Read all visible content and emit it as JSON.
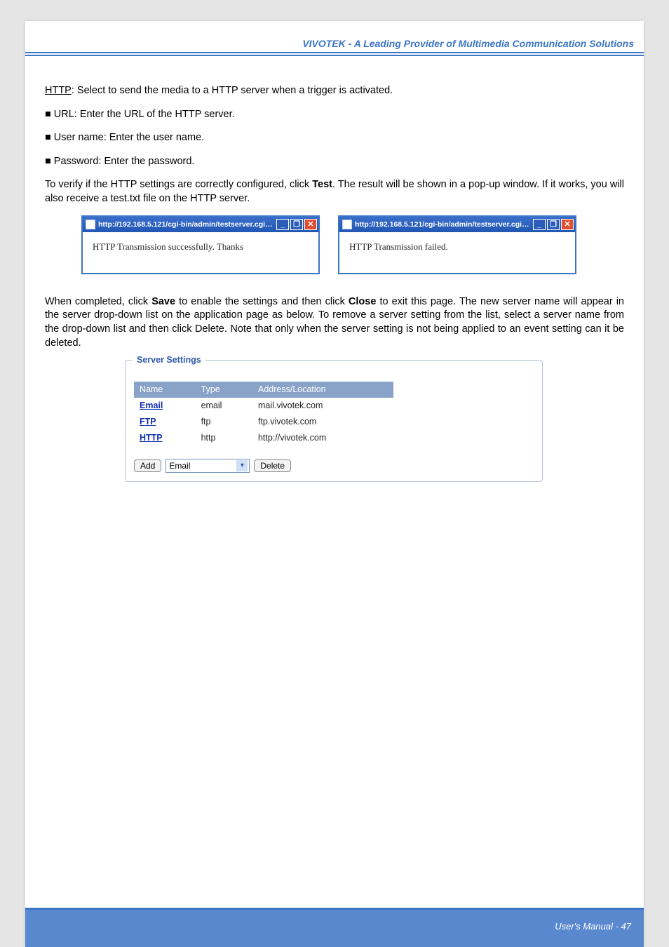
{
  "header": {
    "title": "VIVOTEK - A Leading Provider of Multimedia Communication Solutions"
  },
  "body": {
    "http_label": "HTTP",
    "http_desc": ": Select to send the media to a HTTP server when a trigger is activated.",
    "url_line": "■ URL: Enter the URL of the HTTP server.",
    "user_line": "■ User name: Enter the user name.",
    "pass_line": "■ Password: Enter the password.",
    "verify_pre": "To verify if the HTTP settings are correctly configured, click ",
    "verify_bold": "Test",
    "verify_post": ". The result will be shown in a pop-up window. If it works, you will also receive a test.txt file on the HTTP server.",
    "after_pre": "When completed, click ",
    "after_b1": "Save",
    "after_mid": " to enable the settings and then click ",
    "after_b2": "Close",
    "after_post": " to exit this page. The new server name will appear in the server drop-down list on the application page as below. To remove a server setting from the list, select a server name from the drop-down list and then click Delete. Note that only when the server setting is not being applied to an event setting can it be deleted."
  },
  "popups": {
    "titleA": "http://192.168.5.121/cgi-bin/admin/testserver.cgi - ...",
    "bodyA": "HTTP Transmission successfully. Thanks",
    "titleB": "http://192.168.5.121/cgi-bin/admin/testserver.cgi - ...",
    "bodyB": "HTTP Transmission failed.",
    "min": "_",
    "max": "❐",
    "cls": "✕"
  },
  "panel": {
    "legend": "Server Settings",
    "cols": {
      "c1": "Name",
      "c2": "Type",
      "c3": "Address/Location"
    },
    "rows": [
      {
        "name": "Email",
        "type": "email",
        "addr": "mail.vivotek.com"
      },
      {
        "name": "FTP",
        "type": "ftp",
        "addr": "ftp.vivotek.com"
      },
      {
        "name": "HTTP",
        "type": "http",
        "addr": "http://vivotek.com"
      }
    ],
    "add": "Add",
    "select_value": "Email",
    "delete": "Delete"
  },
  "footer": {
    "text": "User's Manual - 47"
  }
}
